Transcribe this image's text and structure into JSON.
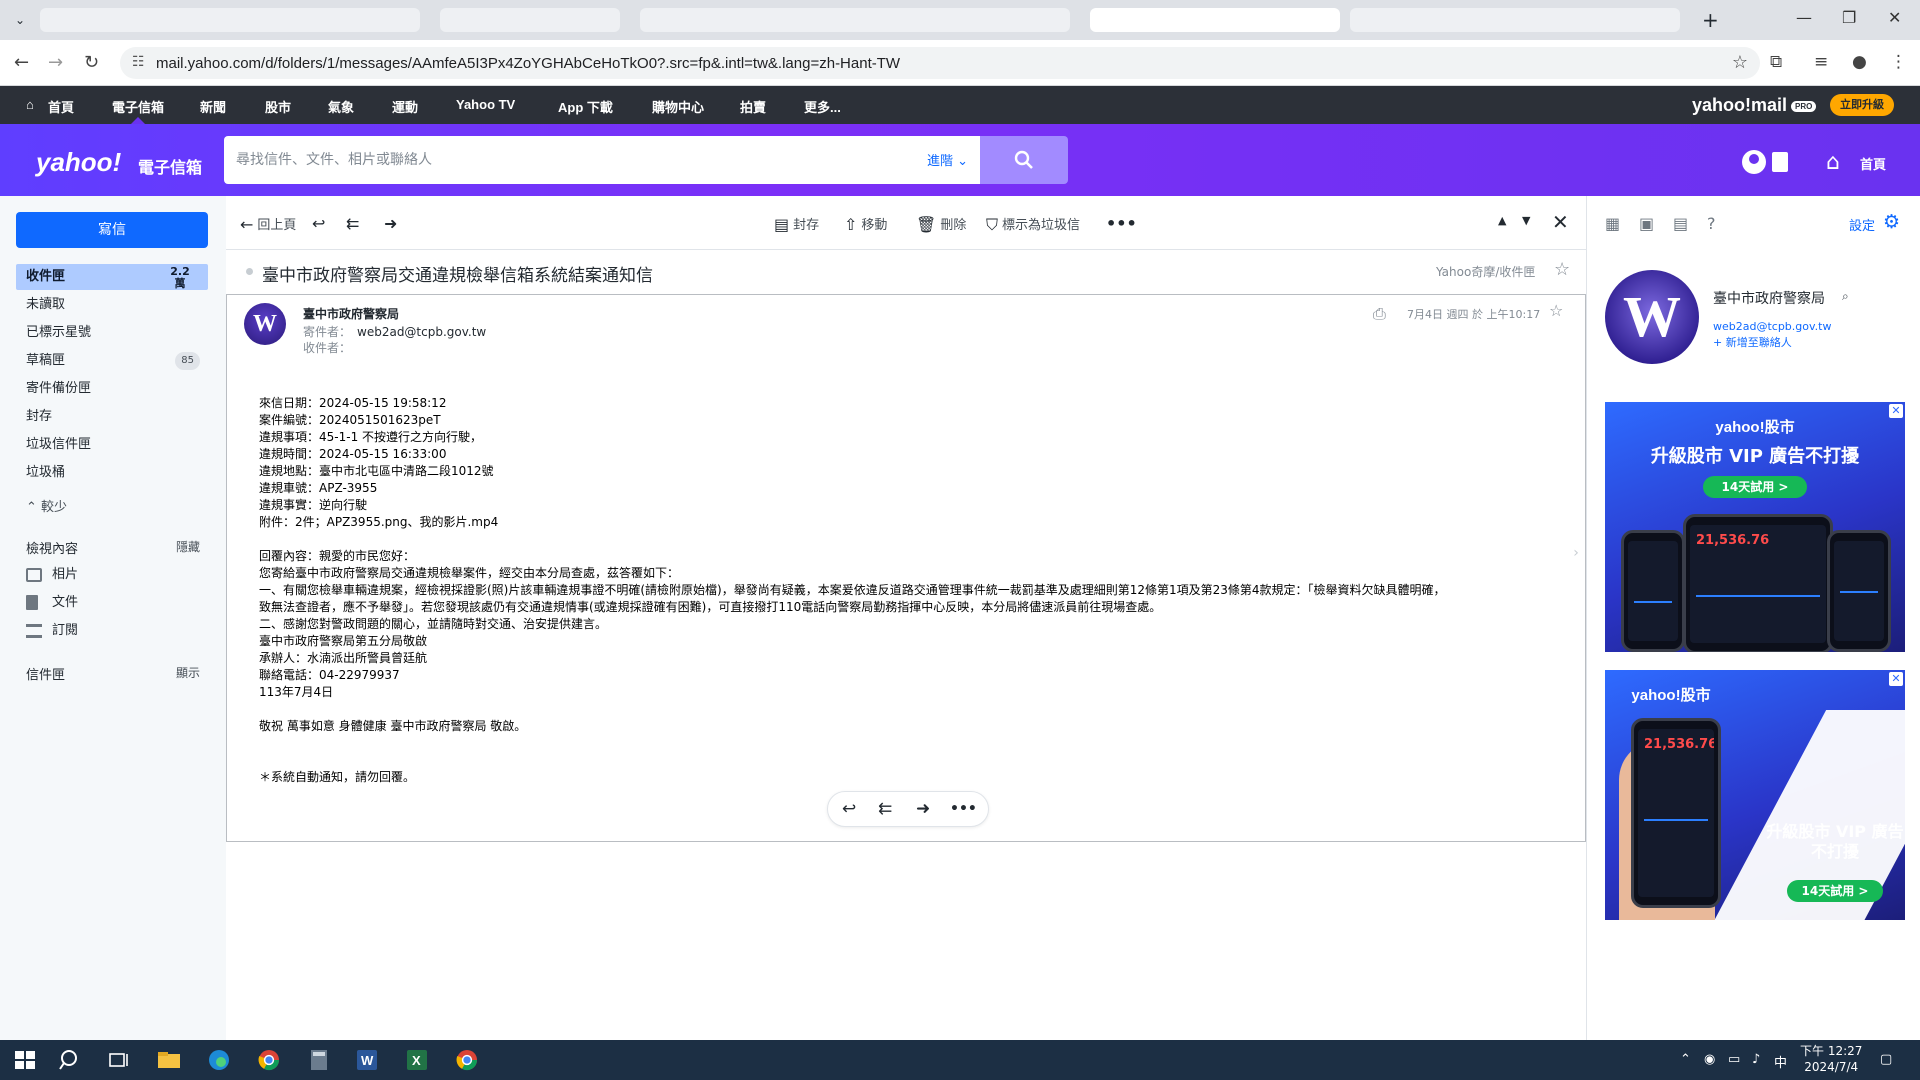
{
  "browser": {
    "url": "mail.yahoo.com/d/folders/1/messages/AAmfeA5I3Px4ZoYGHAbCeHoTkO0?.src=fp&.intl=tw&.lang=zh-Hant-TW"
  },
  "ynav": {
    "items": [
      "首頁",
      "電子信箱",
      "新聞",
      "股市",
      "氣象",
      "運動",
      "Yahoo TV",
      "App 下載",
      "購物中心",
      "拍賣",
      "更多..."
    ],
    "brand": "yahoo!mail",
    "brand_badge": "PRO",
    "upgrade_label": "立即升級"
  },
  "header": {
    "logo": "yahoo!",
    "logo_sub": "電子信箱",
    "search_placeholder": "尋找信件、文件、相片或聯絡人",
    "advanced_label": "進階",
    "home_label": "首頁"
  },
  "sidebar": {
    "compose_label": "寫信",
    "folders": [
      {
        "label": "收件匣",
        "count": "2.2 萬",
        "active": true
      },
      {
        "label": "未讀取",
        "count": ""
      },
      {
        "label": "已標示星號",
        "count": ""
      },
      {
        "label": "草稿匣",
        "count": "85"
      },
      {
        "label": "寄件備份匣",
        "count": ""
      },
      {
        "label": "封存",
        "count": ""
      },
      {
        "label": "垃圾信件匣",
        "count": ""
      },
      {
        "label": "垃圾桶",
        "count": ""
      }
    ],
    "less_label": "較少",
    "views_label": "檢視內容",
    "views_action": "隱藏",
    "views": [
      "相片",
      "文件",
      "訂閱"
    ],
    "folders_label": "信件匣",
    "folders_action": "顯示"
  },
  "toolbar": {
    "back": "回上頁",
    "archive": "封存",
    "move": "移動",
    "delete": "刪除",
    "spam": "標示為垃圾信"
  },
  "message": {
    "subject": "臺中市政府警察局交通違規檢舉信箱系統結案通知信",
    "folder_path": "Yahoo奇摩/收件匣",
    "sender_name": "臺中市政府警察局",
    "from_label": "寄件者：",
    "from_email": "web2ad@tcpb.gov.tw",
    "to_label": "收件者：",
    "date": "7月4日 週四 於 上午10:17",
    "body": [
      "來信日期：2024-05-15 19:58:12",
      "案件編號：2024051501623peT",
      "違規事項：45-1-1 不按遵行之方向行駛，",
      "違規時間：2024-05-15 16:33:00",
      "違規地點：臺中市北屯區中清路二段1012號",
      "違規車號：APZ-3955",
      "違規事實：逆向行駛",
      "附件：2件；APZ3955.png、我的影片.mp4",
      "",
      "回覆內容：親愛的市民您好：",
      "您寄給臺中市政府警察局交通違規檢舉案件，經交由本分局查處，茲答覆如下：",
      "一、有關您檢舉車輛違規案，經檢視採證影(照)片該車輛違規事證不明確(請檢附原始檔)，舉發尚有疑義，本案爰依違反道路交通管理事件統一裁罰基準及處理細則第12條第1項及第23條第4款規定：「檢舉資料欠缺具體明確，",
      "致無法查證者，應不予舉發」。若您發現該處仍有交通違規情事(或違規採證確有困難)，可直接撥打110電話向警察局勤務指揮中心反映，本分局將儘速派員前往現場查處。",
      "二、感謝您對警政問題的關心，並請隨時對交通、治安提供建言。",
      "臺中市政府警察局第五分局敬啟",
      "承辦人：水湳派出所警員曾廷航",
      "聯絡電話：04-22979937",
      "113年7月4日",
      "",
      "敬祝 萬事如意 身體健康 臺中市政府警察局 敬啟。",
      "",
      "",
      "＊系統自動通知，請勿回覆。"
    ]
  },
  "rightpanel": {
    "settings_label": "設定",
    "contact_name": "臺中市政府警察局",
    "contact_email": "web2ad@tcpb.gov.tw",
    "add_contact": "+ 新增至聯絡人"
  },
  "ads": [
    {
      "brand": "yahoo!股市",
      "headline": "升級股市 VIP 廣告不打擾",
      "cta": "14天試用 >",
      "price": "21,536.76"
    },
    {
      "brand": "yahoo!股市",
      "headline": "升級股市 VIP 廣告不打擾",
      "cta": "14天試用 >",
      "price": "21,536.76"
    }
  ],
  "taskbar": {
    "ime": "中",
    "time": "下午 12:27",
    "date": "2024/7/4"
  }
}
